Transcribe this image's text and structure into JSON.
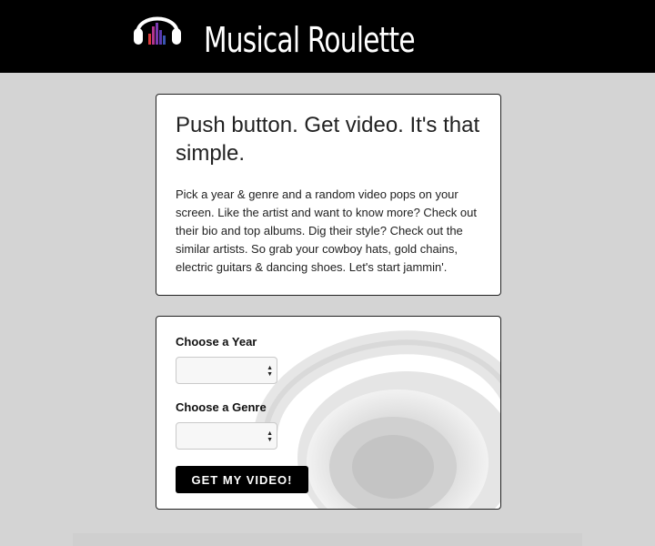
{
  "header": {
    "brand": "Musical Roulette",
    "logo_icon": "headphones-equalizer-icon"
  },
  "intro": {
    "heading": "Push button. Get video. It's that simple.",
    "body": "Pick a year & genre and a random video pops on your screen. Like the artist and want to know more? Check out their bio and top albums. Dig their style? Check out the similar artists. So grab your cowboy hats, gold chains, electric guitars & dancing shoes. Let's start jammin'."
  },
  "form": {
    "year_label": "Choose a Year",
    "year_value": "",
    "genre_label": "Choose a Genre",
    "genre_value": "",
    "submit_label": "GET MY VIDEO!",
    "background_icon": "headphones-photo"
  },
  "colors": {
    "header_bg": "#000000",
    "page_bg": "#d4d4d4",
    "button_bg": "#000000",
    "logo_bars": [
      "#d83a3a",
      "#b2358f",
      "#7a3ab0",
      "#3a55b0"
    ]
  }
}
